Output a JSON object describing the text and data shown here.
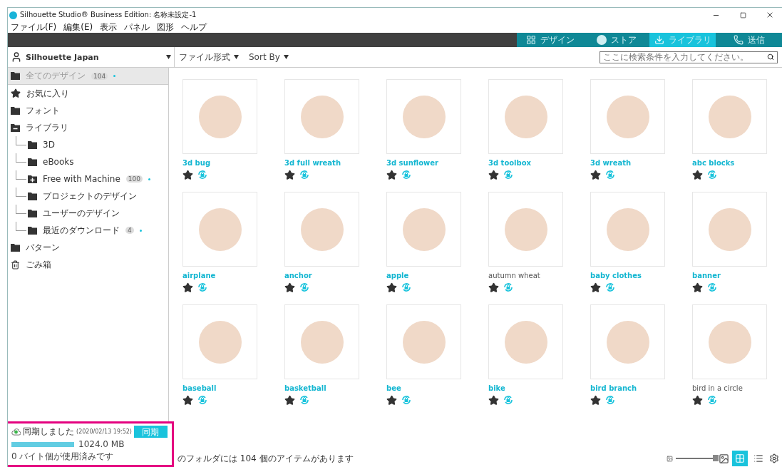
{
  "window": {
    "title": "Silhouette Studio® Business Edition: 名称未設定-1"
  },
  "menu": [
    "ファイル(F)",
    "編集(E)",
    "表示",
    "パネル",
    "図形",
    "ヘルプ"
  ],
  "nav_tabs": [
    {
      "label": "デザイン",
      "kind": "grid",
      "selected": false
    },
    {
      "label": "ストア",
      "kind": "store",
      "selected": false
    },
    {
      "label": "ライブラリ",
      "kind": "library",
      "selected": true
    },
    {
      "label": "送信",
      "kind": "send",
      "selected": false
    }
  ],
  "account": {
    "name": "Silhouette Japan"
  },
  "filters": [
    "ファイル形式",
    "Sort By"
  ],
  "search": {
    "placeholder": "ここに検索条件を入力してください。"
  },
  "sidebar": {
    "items": [
      {
        "label": "全てのデザイン",
        "kind": "folder",
        "count": "104",
        "selected": true
      },
      {
        "label": "お気に入り",
        "kind": "star",
        "selected": false
      },
      {
        "label": "フォント",
        "kind": "folder",
        "selected": false
      },
      {
        "label": "ライブラリ",
        "kind": "folder-open",
        "selected": false,
        "expanded": true,
        "children": [
          {
            "label": "3D",
            "kind": "folder",
            "selected": false
          },
          {
            "label": "eBooks",
            "kind": "folder",
            "selected": false
          },
          {
            "label": "Free with Machine",
            "kind": "folder-plus",
            "count": "100",
            "selected": false
          },
          {
            "label": "プロジェクトのデザイン",
            "kind": "folder",
            "selected": false
          },
          {
            "label": "ユーザーのデザイン",
            "kind": "folder",
            "selected": false
          },
          {
            "label": "最近のダウンロード",
            "kind": "folder",
            "count": "4",
            "selected": false
          }
        ]
      },
      {
        "label": "パターン",
        "kind": "folder",
        "selected": false
      },
      {
        "label": "ごみ箱",
        "kind": "trash",
        "selected": false
      }
    ]
  },
  "designs": [
    {
      "name": "3d bug",
      "highlighted": true
    },
    {
      "name": "3d full wreath",
      "highlighted": true
    },
    {
      "name": "3d sunflower",
      "highlighted": true
    },
    {
      "name": "3d toolbox",
      "highlighted": true
    },
    {
      "name": "3d wreath",
      "highlighted": true
    },
    {
      "name": "abc blocks",
      "highlighted": true
    },
    {
      "name": "airplane",
      "highlighted": true
    },
    {
      "name": "anchor",
      "highlighted": true
    },
    {
      "name": "apple",
      "highlighted": true
    },
    {
      "name": "autumn wheat",
      "highlighted": false
    },
    {
      "name": "baby clothes",
      "highlighted": true
    },
    {
      "name": "banner",
      "highlighted": true
    },
    {
      "name": "baseball",
      "highlighted": true
    },
    {
      "name": "basketball",
      "highlighted": true
    },
    {
      "name": "bee",
      "highlighted": true
    },
    {
      "name": "bike",
      "highlighted": true
    },
    {
      "name": "bird branch",
      "highlighted": true
    },
    {
      "name": "bird in a circle",
      "highlighted": false
    }
  ],
  "sync": {
    "status": "同期しました",
    "time": "(2020/02/13 19:52)",
    "button": "同期",
    "storage": "1024.0 MB",
    "level": 1,
    "used": "0 バイト個が使用済みです"
  },
  "status_bar": {
    "text": "のフォルダには 104 個のアイテムがあります",
    "zoom": {
      "level": 1
    },
    "views": [
      {
        "kind": "grid",
        "selected": true
      },
      {
        "kind": "list",
        "selected": false
      }
    ]
  }
}
